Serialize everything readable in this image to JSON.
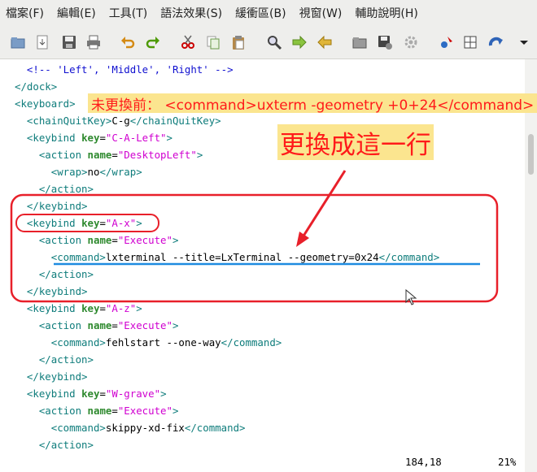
{
  "menu": [
    "檔案(F)",
    "編輯(E)",
    "工具(T)",
    "語法效果(S)",
    "緩衝區(B)",
    "視窗(W)",
    "輔助說明(H)"
  ],
  "toolbar": {
    "icons": [
      "open-file-icon",
      "load-icon",
      "save-icon",
      "print-icon",
      "undo-icon",
      "redo-icon",
      "cut-icon",
      "copy-icon",
      "paste-icon",
      "find-replace-icon",
      "forward-icon",
      "back-icon",
      "load-session-icon",
      "save-session-icon",
      "settings-icon",
      "run-icon",
      "table-icon",
      "jump-icon",
      "dropdown-arrow-icon"
    ]
  },
  "code_lines": [
    [
      {
        "t": "  <!-- 'Left', 'Middle', 'Right' -->",
        "c": "comment"
      }
    ],
    [
      {
        "t": "</dock>",
        "c": "tag"
      }
    ],
    [
      {
        "t": "<keyboard>",
        "c": "tag"
      }
    ],
    [
      {
        "t": "  <chainQuitKey>",
        "c": "tag"
      },
      {
        "t": "C-g",
        "c": "text"
      },
      {
        "t": "</chainQuitKey>",
        "c": "tag"
      }
    ],
    [
      {
        "t": "  <keybind ",
        "c": "tag"
      },
      {
        "t": "key",
        "c": "attr"
      },
      {
        "t": "=",
        "c": "text"
      },
      {
        "t": "\"C-A-Left\"",
        "c": "val"
      },
      {
        "t": ">",
        "c": "tag"
      }
    ],
    [
      {
        "t": "    <action ",
        "c": "tag"
      },
      {
        "t": "name",
        "c": "attr"
      },
      {
        "t": "=",
        "c": "text"
      },
      {
        "t": "\"DesktopLeft\"",
        "c": "val"
      },
      {
        "t": ">",
        "c": "tag"
      }
    ],
    [
      {
        "t": "      <wrap>",
        "c": "tag"
      },
      {
        "t": "no",
        "c": "text"
      },
      {
        "t": "</wrap>",
        "c": "tag"
      }
    ],
    [
      {
        "t": "    </action>",
        "c": "tag"
      }
    ],
    [
      {
        "t": "  </keybind>",
        "c": "tag"
      }
    ],
    [
      {
        "t": "  <keybind ",
        "c": "tag"
      },
      {
        "t": "key",
        "c": "attr"
      },
      {
        "t": "=",
        "c": "text"
      },
      {
        "t": "\"A-x\"",
        "c": "val"
      },
      {
        "t": ">",
        "c": "tag"
      }
    ],
    [
      {
        "t": "    <action ",
        "c": "tag"
      },
      {
        "t": "name",
        "c": "attr"
      },
      {
        "t": "=",
        "c": "text"
      },
      {
        "t": "\"Execute\"",
        "c": "val"
      },
      {
        "t": ">",
        "c": "tag"
      }
    ],
    [
      {
        "t": "      <command>",
        "c": "tag"
      },
      {
        "t": "lxterminal --title=LxTerminal --geometry=0x24",
        "c": "text"
      },
      {
        "t": "</command>",
        "c": "tag"
      }
    ],
    [
      {
        "t": "    </action>",
        "c": "tag"
      }
    ],
    [
      {
        "t": "  </keybind>",
        "c": "tag"
      }
    ],
    [
      {
        "t": "  <keybind ",
        "c": "tag"
      },
      {
        "t": "key",
        "c": "attr"
      },
      {
        "t": "=",
        "c": "text"
      },
      {
        "t": "\"A-z\"",
        "c": "val"
      },
      {
        "t": ">",
        "c": "tag"
      }
    ],
    [
      {
        "t": "    <action ",
        "c": "tag"
      },
      {
        "t": "name",
        "c": "attr"
      },
      {
        "t": "=",
        "c": "text"
      },
      {
        "t": "\"Execute\"",
        "c": "val"
      },
      {
        "t": ">",
        "c": "tag"
      }
    ],
    [
      {
        "t": "      <command>",
        "c": "tag"
      },
      {
        "t": "fehlstart --one-way",
        "c": "text"
      },
      {
        "t": "</command>",
        "c": "tag"
      }
    ],
    [
      {
        "t": "    </action>",
        "c": "tag"
      }
    ],
    [
      {
        "t": "  </keybind>",
        "c": "tag"
      }
    ],
    [
      {
        "t": "  <keybind ",
        "c": "tag"
      },
      {
        "t": "key",
        "c": "attr"
      },
      {
        "t": "=",
        "c": "text"
      },
      {
        "t": "\"W-grave\"",
        "c": "val"
      },
      {
        "t": ">",
        "c": "tag"
      }
    ],
    [
      {
        "t": "    <action ",
        "c": "tag"
      },
      {
        "t": "name",
        "c": "attr"
      },
      {
        "t": "=",
        "c": "text"
      },
      {
        "t": "\"Execute\"",
        "c": "val"
      },
      {
        "t": ">",
        "c": "tag"
      }
    ],
    [
      {
        "t": "      <command>",
        "c": "tag"
      },
      {
        "t": "skippy-xd-fix",
        "c": "text"
      },
      {
        "t": "</command>",
        "c": "tag"
      }
    ],
    [
      {
        "t": "    </action>",
        "c": "tag"
      }
    ]
  ],
  "annotation": {
    "note": "未更換前： <command>uxterm -geometry +0+24</command>",
    "callout": "更換成這一行"
  },
  "status": {
    "position": "184,18",
    "percent": "21%"
  },
  "colors": {
    "comment": "#1010d0",
    "tag": "#0e7c7b",
    "attr": "#2f8a2f",
    "value": "#d000d0",
    "annotation_red": "#e8202a",
    "annotation_bg": "#fbe58f",
    "underline_blue": "#1e8be0"
  }
}
